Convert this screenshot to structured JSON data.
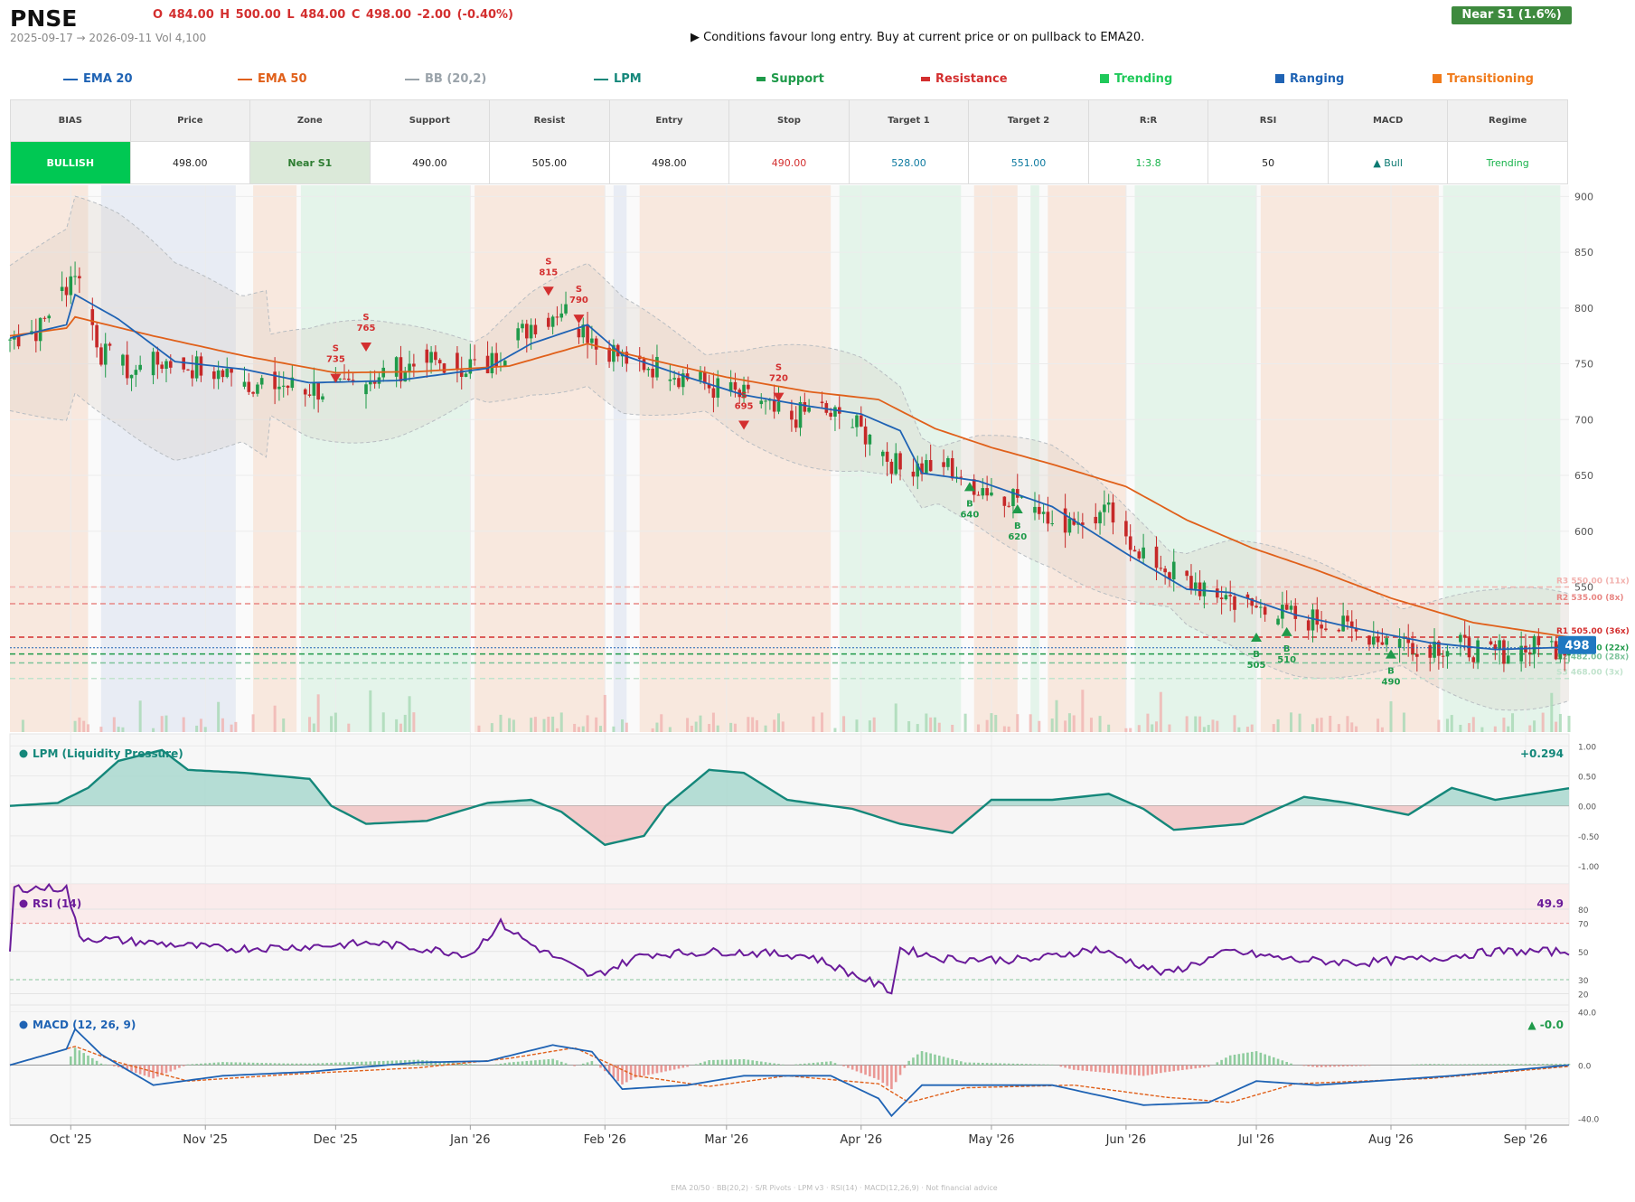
{
  "header": {
    "ticker": "PNSE",
    "ohlc_text": "O 484.00   H 500.00   L 484.00   C 498.00   -2.00  (-0.40%)",
    "range_text": "2025-09-17 → 2026-09-11   Vol 4,100",
    "signal_text": "▶  Conditions favour long entry. Buy at current price or on pullback to EMA20.",
    "badge": "Near S1  (1.6%)"
  },
  "legend": [
    {
      "label": "EMA 20",
      "color": "#1f63b4",
      "kind": "line"
    },
    {
      "label": "EMA 50",
      "color": "#e0601a",
      "kind": "line"
    },
    {
      "label": "BB (20,2)",
      "color": "#9aa3aa",
      "kind": "line"
    },
    {
      "label": "LPM",
      "color": "#14877a",
      "kind": "line"
    },
    {
      "label": "Support",
      "color": "#1f9a4a",
      "kind": "bar"
    },
    {
      "label": "Resistance",
      "color": "#d32f2f",
      "kind": "bar"
    },
    {
      "label": "Trending",
      "color": "#1fc95a",
      "kind": "square"
    },
    {
      "label": "Ranging",
      "color": "#1f63b4",
      "kind": "square"
    },
    {
      "label": "Transitioning",
      "color": "#f07a1a",
      "kind": "square"
    }
  ],
  "summary": {
    "headers": [
      "BIAS",
      "Price",
      "Zone",
      "Support",
      "Resist",
      "Entry",
      "Stop",
      "Target 1",
      "Target 2",
      "R:R",
      "RSI",
      "MACD",
      "Regime"
    ],
    "values": [
      "BULLISH",
      "498.00",
      "Near S1",
      "490.00",
      "505.00",
      "498.00",
      "490.00",
      "528.00",
      "551.00",
      "1:3.8",
      "50",
      "▲ Bull",
      "Trending"
    ]
  },
  "colors": {
    "up": "#1f9a4a",
    "down": "#c62828",
    "accent": "#1f63b4"
  },
  "chart_data": {
    "type": "candlestick",
    "x_range": [
      "2025-09-17",
      "2026-09-11"
    ],
    "x_ticks": [
      {
        "label": "Oct '25",
        "date": "2025-10-01"
      },
      {
        "label": "Nov '25",
        "date": "2025-11-01"
      },
      {
        "label": "Dec '25",
        "date": "2025-12-01"
      },
      {
        "label": "Jan '26",
        "date": "2026-01-01"
      },
      {
        "label": "Feb '26",
        "date": "2026-02-01"
      },
      {
        "label": "Mar '26",
        "date": "2026-03-01"
      },
      {
        "label": "Apr '26",
        "date": "2026-04-01"
      },
      {
        "label": "May '26",
        "date": "2026-05-01"
      },
      {
        "label": "Jun '26",
        "date": "2026-06-01"
      },
      {
        "label": "Jul '26",
        "date": "2026-07-01"
      },
      {
        "label": "Aug '26",
        "date": "2026-08-01"
      },
      {
        "label": "Sep '26",
        "date": "2026-09-01"
      }
    ],
    "price": {
      "ylim": [
        420,
        910
      ],
      "yticks": [
        550,
        600,
        650,
        700,
        750,
        800,
        850,
        900
      ],
      "last_price_label": "498",
      "last_price": 498,
      "close_anchors": [
        [
          "2025-09-17",
          772
        ],
        [
          "2025-09-24",
          782
        ],
        [
          "2025-10-02",
          835
        ],
        [
          "2025-10-08",
          760
        ],
        [
          "2025-10-15",
          742
        ],
        [
          "2025-10-22",
          752
        ],
        [
          "2025-11-01",
          745
        ],
        [
          "2025-11-10",
          735
        ],
        [
          "2025-11-20",
          730
        ],
        [
          "2025-12-01",
          725
        ],
        [
          "2025-12-12",
          742
        ],
        [
          "2025-12-22",
          752
        ],
        [
          "2026-01-05",
          748
        ],
        [
          "2026-01-15",
          785
        ],
        [
          "2026-01-22",
          800
        ],
        [
          "2026-01-29",
          775
        ],
        [
          "2026-02-05",
          755
        ],
        [
          "2026-02-15",
          745
        ],
        [
          "2026-02-25",
          730
        ],
        [
          "2026-03-05",
          720
        ],
        [
          "2026-03-15",
          700
        ],
        [
          "2026-03-22",
          710
        ],
        [
          "2026-04-01",
          690
        ],
        [
          "2026-04-10",
          655
        ],
        [
          "2026-04-20",
          660
        ],
        [
          "2026-04-28",
          640
        ],
        [
          "2026-05-08",
          630
        ],
        [
          "2026-05-18",
          610
        ],
        [
          "2026-05-28",
          615
        ],
        [
          "2026-06-05",
          580
        ],
        [
          "2026-06-15",
          555
        ],
        [
          "2026-06-25",
          540
        ],
        [
          "2026-07-05",
          525
        ],
        [
          "2026-07-15",
          520
        ],
        [
          "2026-07-25",
          508
        ],
        [
          "2026-08-05",
          500
        ],
        [
          "2026-08-15",
          497
        ],
        [
          "2026-08-25",
          492
        ],
        [
          "2026-09-11",
          498
        ]
      ],
      "ema20_anchors": [
        [
          "2025-09-17",
          773
        ],
        [
          "2025-09-30",
          785
        ],
        [
          "2025-10-02",
          812
        ],
        [
          "2025-10-12",
          790
        ],
        [
          "2025-10-25",
          752
        ],
        [
          "2025-11-10",
          745
        ],
        [
          "2025-11-25",
          733
        ],
        [
          "2025-12-15",
          735
        ],
        [
          "2026-01-05",
          746
        ],
        [
          "2026-01-15",
          768
        ],
        [
          "2026-01-28",
          785
        ],
        [
          "2026-02-05",
          758
        ],
        [
          "2026-02-20",
          738
        ],
        [
          "2026-03-05",
          722
        ],
        [
          "2026-03-20",
          712
        ],
        [
          "2026-04-01",
          705
        ],
        [
          "2026-04-10",
          690
        ],
        [
          "2026-04-15",
          652
        ],
        [
          "2026-04-28",
          645
        ],
        [
          "2026-05-15",
          622
        ],
        [
          "2026-06-01",
          580
        ],
        [
          "2026-06-15",
          548
        ],
        [
          "2026-06-25",
          545
        ],
        [
          "2026-07-10",
          525
        ],
        [
          "2026-07-25",
          512
        ],
        [
          "2026-08-10",
          500
        ],
        [
          "2026-08-25",
          494
        ],
        [
          "2026-09-11",
          496
        ]
      ],
      "ema50_anchors": [
        [
          "2025-09-17",
          775
        ],
        [
          "2025-09-30",
          782
        ],
        [
          "2025-10-02",
          792
        ],
        [
          "2025-10-20",
          775
        ],
        [
          "2025-11-10",
          757
        ],
        [
          "2025-12-01",
          742
        ],
        [
          "2025-12-20",
          743
        ],
        [
          "2026-01-10",
          748
        ],
        [
          "2026-01-28",
          768
        ],
        [
          "2026-02-10",
          755
        ],
        [
          "2026-03-01",
          738
        ],
        [
          "2026-03-20",
          725
        ],
        [
          "2026-04-05",
          718
        ],
        [
          "2026-04-18",
          692
        ],
        [
          "2026-05-01",
          675
        ],
        [
          "2026-05-15",
          660
        ],
        [
          "2026-06-01",
          640
        ],
        [
          "2026-06-15",
          610
        ],
        [
          "2026-06-30",
          585
        ],
        [
          "2026-07-15",
          565
        ],
        [
          "2026-08-01",
          540
        ],
        [
          "2026-08-20",
          518
        ],
        [
          "2026-09-11",
          505
        ]
      ],
      "levels": [
        {
          "label": "R3 550.00 (11x)",
          "value": 550,
          "color": "#f2b1ae",
          "style": "dashed"
        },
        {
          "label": "R2 535.00 (8x)",
          "value": 535,
          "color": "#e88683",
          "style": "dashed"
        },
        {
          "label": "R1 505.00 (36x)",
          "value": 505,
          "color": "#d32f2f",
          "style": "dashed"
        },
        {
          "label": "S1 490.00 (22x)",
          "value": 490,
          "color": "#1f9a4a",
          "style": "dashed"
        },
        {
          "label": "S2 482.00 (28x)",
          "value": 482,
          "color": "#7cc39a",
          "style": "dashed"
        },
        {
          "label": "S3 468.00 (3x)",
          "value": 468,
          "color": "#c1e3cd",
          "style": "dashed"
        }
      ],
      "regimes": [
        {
          "from": "2025-09-17",
          "to": "2025-10-05",
          "type": "Transitioning"
        },
        {
          "from": "2025-10-08",
          "to": "2025-11-08",
          "type": "Ranging"
        },
        {
          "from": "2025-11-12",
          "to": "2025-11-22",
          "type": "Transitioning"
        },
        {
          "from": "2025-11-23",
          "to": "2026-01-01",
          "type": "Trending"
        },
        {
          "from": "2026-01-02",
          "to": "2026-02-01",
          "type": "Transitioning"
        },
        {
          "from": "2026-02-03",
          "to": "2026-02-06",
          "type": "Ranging"
        },
        {
          "from": "2026-02-09",
          "to": "2026-03-25",
          "type": "Transitioning"
        },
        {
          "from": "2026-03-27",
          "to": "2026-04-24",
          "type": "Trending"
        },
        {
          "from": "2026-04-27",
          "to": "2026-05-07",
          "type": "Transitioning"
        },
        {
          "from": "2026-05-10",
          "to": "2026-05-12",
          "type": "Trending"
        },
        {
          "from": "2026-05-14",
          "to": "2026-06-01",
          "type": "Transitioning"
        },
        {
          "from": "2026-06-03",
          "to": "2026-07-01",
          "type": "Trending"
        },
        {
          "from": "2026-07-02",
          "to": "2026-08-12",
          "type": "Transitioning"
        },
        {
          "from": "2026-08-13",
          "to": "2026-09-09",
          "type": "Trending"
        }
      ],
      "signals": [
        {
          "kind": "S",
          "value": "735",
          "date": "2025-12-01",
          "price": 737
        },
        {
          "kind": "S",
          "value": "765",
          "date": "2025-12-08",
          "price": 765
        },
        {
          "kind": "S",
          "value": "815",
          "date": "2026-01-19",
          "price": 815
        },
        {
          "kind": "S",
          "value": "790",
          "date": "2026-01-26",
          "price": 790
        },
        {
          "kind": "S",
          "value": "695",
          "date": "2026-03-05",
          "price": 695
        },
        {
          "kind": "S",
          "value": "720",
          "date": "2026-03-13",
          "price": 720
        },
        {
          "kind": "B",
          "value": "640",
          "date": "2026-04-26",
          "price": 640
        },
        {
          "kind": "B",
          "value": "620",
          "date": "2026-05-07",
          "price": 620
        },
        {
          "kind": "B",
          "value": "505",
          "date": "2026-07-01",
          "price": 505
        },
        {
          "kind": "B",
          "value": "510",
          "date": "2026-07-08",
          "price": 510
        },
        {
          "kind": "B",
          "value": "490",
          "date": "2026-08-01",
          "price": 490
        }
      ]
    },
    "lpm": {
      "title": "LPM (Liquidity Pressure)",
      "value": "+0.294",
      "ylim": [
        -1.3,
        1.2
      ],
      "yticks": [
        "1.00",
        "0.50",
        "0.00",
        "-0.50",
        "-1.00"
      ],
      "ytick_values": [
        1.0,
        0.5,
        0.0,
        -0.5,
        -1.0
      ],
      "anchors": [
        [
          "2025-09-17",
          0
        ],
        [
          "2025-09-28",
          0.05
        ],
        [
          "2025-10-05",
          0.3
        ],
        [
          "2025-10-12",
          0.75
        ],
        [
          "2025-10-22",
          0.93
        ],
        [
          "2025-10-28",
          0.6
        ],
        [
          "2025-11-10",
          0.55
        ],
        [
          "2025-11-25",
          0.45
        ],
        [
          "2025-11-30",
          0.0
        ],
        [
          "2025-12-08",
          -0.3
        ],
        [
          "2025-12-22",
          -0.25
        ],
        [
          "2026-01-05",
          0.05
        ],
        [
          "2026-01-15",
          0.1
        ],
        [
          "2026-01-22",
          -0.1
        ],
        [
          "2026-02-01",
          -0.65
        ],
        [
          "2026-02-10",
          -0.5
        ],
        [
          "2026-02-15",
          0.0
        ],
        [
          "2026-02-25",
          0.6
        ],
        [
          "2026-03-05",
          0.55
        ],
        [
          "2026-03-15",
          0.1
        ],
        [
          "2026-03-30",
          -0.05
        ],
        [
          "2026-04-10",
          -0.3
        ],
        [
          "2026-04-22",
          -0.45
        ],
        [
          "2026-05-01",
          0.1
        ],
        [
          "2026-05-15",
          0.1
        ],
        [
          "2026-05-28",
          0.2
        ],
        [
          "2026-06-05",
          -0.05
        ],
        [
          "2026-06-12",
          -0.4
        ],
        [
          "2026-06-28",
          -0.3
        ],
        [
          "2026-07-12",
          0.15
        ],
        [
          "2026-07-22",
          0.05
        ],
        [
          "2026-08-05",
          -0.15
        ],
        [
          "2026-08-15",
          0.3
        ],
        [
          "2026-08-25",
          0.1
        ],
        [
          "2026-09-11",
          0.294
        ]
      ]
    },
    "rsi": {
      "title": "RSI (14)",
      "value": "49.9",
      "ylim": [
        12,
        98
      ],
      "yticks": [
        80,
        70,
        50,
        30,
        20
      ],
      "anchors": [
        [
          "2025-09-17",
          50
        ],
        [
          "2025-09-18",
          95
        ],
        [
          "2025-09-30",
          95
        ],
        [
          "2025-10-03",
          60
        ],
        [
          "2025-10-20",
          56
        ],
        [
          "2025-11-05",
          52
        ],
        [
          "2025-11-20",
          53
        ],
        [
          "2025-12-10",
          56
        ],
        [
          "2026-01-01",
          48
        ],
        [
          "2026-01-08",
          70
        ],
        [
          "2026-01-15",
          55
        ],
        [
          "2026-01-29",
          32
        ],
        [
          "2026-02-10",
          48
        ],
        [
          "2026-03-01",
          50
        ],
        [
          "2026-03-20",
          47
        ],
        [
          "2026-04-02",
          30
        ],
        [
          "2026-04-08",
          22
        ],
        [
          "2026-04-10",
          52
        ],
        [
          "2026-04-20",
          45
        ],
        [
          "2026-05-10",
          44
        ],
        [
          "2026-05-25",
          52
        ],
        [
          "2026-06-10",
          34
        ],
        [
          "2026-06-25",
          50
        ],
        [
          "2026-07-10",
          44
        ],
        [
          "2026-07-25",
          42
        ],
        [
          "2026-08-10",
          45
        ],
        [
          "2026-08-25",
          50
        ],
        [
          "2026-09-11",
          49.9
        ]
      ]
    },
    "macd": {
      "title": "MACD (12, 26, 9)",
      "value": "▲ -0.0",
      "ylim": [
        -45,
        45
      ],
      "yticks": [
        "40.0",
        "0.0",
        "-40.0"
      ],
      "ytick_values": [
        40,
        0,
        -40
      ],
      "macd_anchors": [
        [
          "2025-09-17",
          0
        ],
        [
          "2025-09-30",
          12
        ],
        [
          "2025-10-02",
          27
        ],
        [
          "2025-10-08",
          8
        ],
        [
          "2025-10-20",
          -15
        ],
        [
          "2025-11-05",
          -8
        ],
        [
          "2025-11-25",
          -5
        ],
        [
          "2025-12-20",
          2
        ],
        [
          "2026-01-05",
          3
        ],
        [
          "2026-01-20",
          15
        ],
        [
          "2026-01-29",
          10
        ],
        [
          "2026-02-05",
          -18
        ],
        [
          "2026-02-20",
          -15
        ],
        [
          "2026-03-05",
          -8
        ],
        [
          "2026-03-25",
          -8
        ],
        [
          "2026-04-05",
          -25
        ],
        [
          "2026-04-08",
          -38
        ],
        [
          "2026-04-15",
          -15
        ],
        [
          "2026-05-15",
          -15
        ],
        [
          "2026-06-05",
          -30
        ],
        [
          "2026-06-20",
          -28
        ],
        [
          "2026-07-01",
          -12
        ],
        [
          "2026-07-15",
          -15
        ],
        [
          "2026-08-15",
          -8
        ],
        [
          "2026-09-11",
          0
        ]
      ],
      "signal_anchors": [
        [
          "2025-09-17",
          0
        ],
        [
          "2025-10-02",
          14
        ],
        [
          "2025-10-12",
          2
        ],
        [
          "2025-10-28",
          -12
        ],
        [
          "2025-11-20",
          -7
        ],
        [
          "2025-12-20",
          -2
        ],
        [
          "2026-01-10",
          5
        ],
        [
          "2026-01-25",
          13
        ],
        [
          "2026-02-08",
          -8
        ],
        [
          "2026-02-25",
          -16
        ],
        [
          "2026-03-15",
          -8
        ],
        [
          "2026-04-05",
          -14
        ],
        [
          "2026-04-12",
          -28
        ],
        [
          "2026-04-25",
          -17
        ],
        [
          "2026-05-20",
          -15
        ],
        [
          "2026-06-10",
          -24
        ],
        [
          "2026-06-25",
          -28
        ],
        [
          "2026-07-10",
          -14
        ],
        [
          "2026-08-10",
          -10
        ],
        [
          "2026-09-11",
          -1
        ]
      ]
    }
  },
  "footer": "EMA 20/50  ·  BB(20,2)  ·  S/R Pivots  ·  LPM v3  ·  RSI(14)  ·  MACD(12,26,9)  ·  Not financial advice"
}
